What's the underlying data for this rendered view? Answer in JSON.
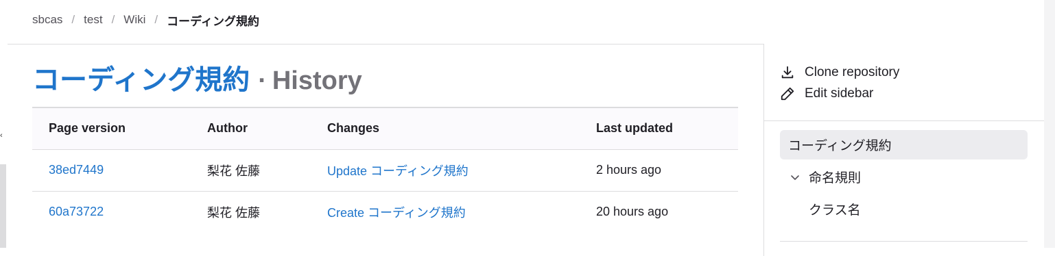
{
  "breadcrumb": {
    "items": [
      "sbcas",
      "test",
      "Wiki"
    ],
    "separator": "/",
    "current": "コーディング規約"
  },
  "page": {
    "title_link": "コーディング規約",
    "title_separator": "·",
    "title_suffix": "History"
  },
  "table": {
    "headers": [
      "Page version",
      "Author",
      "Changes",
      "Last updated"
    ],
    "rows": [
      {
        "version": "38ed7449",
        "author": "梨花 佐藤",
        "change": "Update コーディング規約",
        "updated": "2 hours ago"
      },
      {
        "version": "60a73722",
        "author": "梨花 佐藤",
        "change": "Create コーディング規約",
        "updated": "20 hours ago"
      }
    ]
  },
  "sidebar": {
    "actions": [
      {
        "label": "Clone repository",
        "icon": "download-icon"
      },
      {
        "label": "Edit sidebar",
        "icon": "pencil-icon"
      }
    ],
    "nav": [
      {
        "label": "コーディング規約",
        "active": true
      },
      {
        "label": "命名規則",
        "icon": "chevron-down-icon"
      },
      {
        "label": "クラス名"
      }
    ]
  },
  "colors": {
    "link": "#1f75cb",
    "muted": "#737278",
    "active_bg": "#ececef"
  }
}
